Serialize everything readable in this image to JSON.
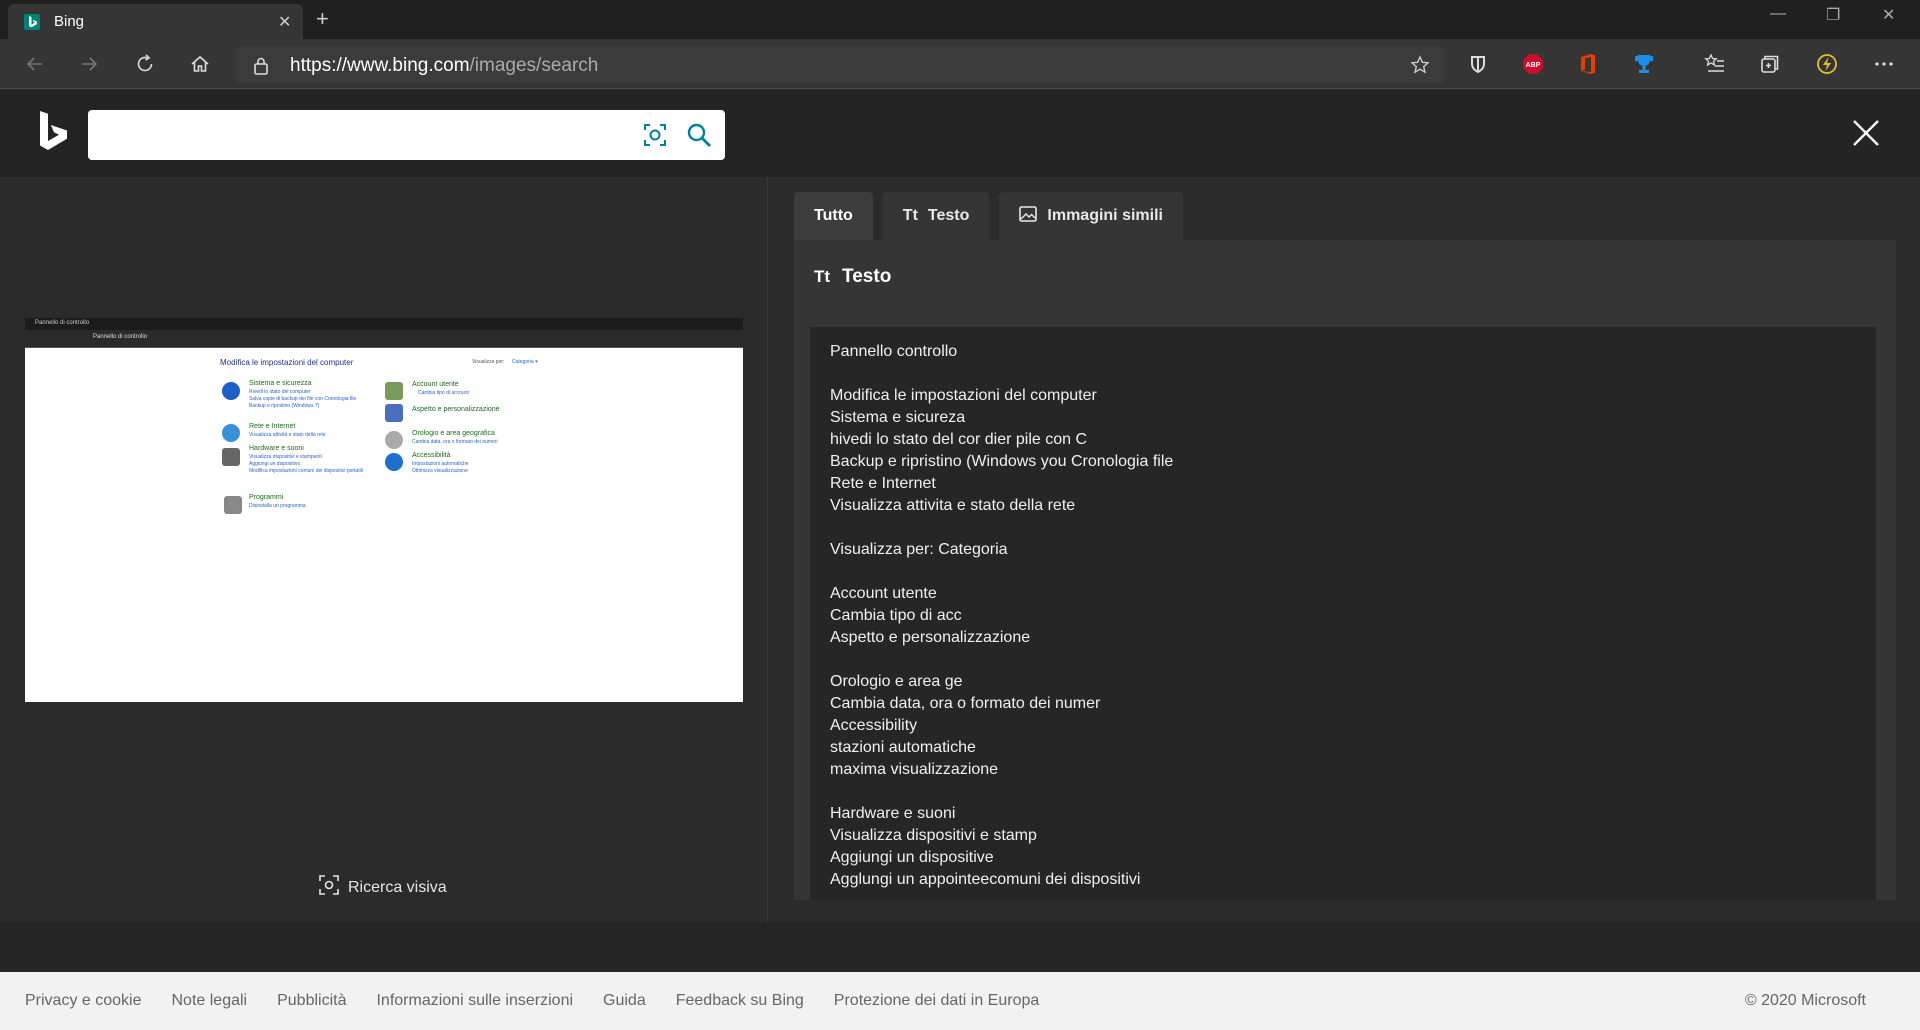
{
  "browser": {
    "tab_title": "Bing",
    "url_host": "https://www.bing.com",
    "url_path": "/images/search",
    "colors": {
      "chrome_dark": "#202020",
      "toolbar": "#353535",
      "bing_teal": "#008373"
    }
  },
  "extensions": [
    "shield-extension",
    "adblock-plus",
    "office",
    "trophy-extension",
    "favorites",
    "collections",
    "performance",
    "more"
  ],
  "extension_labels": {
    "adblock": "ABP"
  },
  "bing": {
    "search_placeholder": "",
    "visual_search_label": "Ricerca visiva"
  },
  "preview": {
    "window_title": "Pannello di controllo",
    "address": "Pannello di controllo",
    "heading": "Modifica le impostazioni del computer",
    "view_by": "Visualizza per:",
    "view_value": "Categoria ▾",
    "items": [
      {
        "title": "Sistema e sicurezza",
        "subs": [
          "Rivedi lo stato del computer",
          "Salva copie di backup dei file con Cronologia file",
          "Backup e ripristino (Windows 7)"
        ]
      },
      {
        "title": "Rete e Internet",
        "subs": [
          "Visualizza attività e stato della rete"
        ]
      },
      {
        "title": "Hardware e suoni",
        "subs": [
          "Visualizza dispositivi e stampanti",
          "Aggiungi un dispositivo",
          "Modifica impostazioni comuni dei dispositivi portatili"
        ]
      },
      {
        "title": "Programmi",
        "subs": [
          "Disinstalla un programma"
        ]
      },
      {
        "title": "Account utente",
        "subs": [
          "Cambia tipo di account"
        ]
      },
      {
        "title": "Aspetto e personalizzazione",
        "subs": []
      },
      {
        "title": "Orologio e area geografica",
        "subs": [
          "Cambia data, ora o formato dei numeri"
        ]
      },
      {
        "title": "Accessibilità",
        "subs": [
          "Impostazioni automatiche",
          "Ottimizza visualizzazione"
        ]
      }
    ]
  },
  "results": {
    "tabs": [
      {
        "label": "Tutto",
        "active": true
      },
      {
        "label": "Testo",
        "active": false
      },
      {
        "label": "Immagini simili",
        "active": false
      }
    ],
    "tt_glyph": "Tt",
    "section_title": "Testo",
    "text_lines": [
      "Pannello controllo",
      "",
      "Modifica le impostazioni del computer",
      "Sistema e sicureza",
      "hivedi lo stato del cor dier pile con C",
      "Backup e ripristino (Windows you Cronologia file",
      "Rete e Internet",
      "Visualizza attivita e stato della rete",
      "",
      "Visualizza per: Categoria",
      "",
      "Account utente",
      "Cambia tipo di acc",
      "Aspetto e personalizzazione",
      "",
      "Orologio e area ge",
      "Cambia data, ora o formato dei numer",
      "Accessibility",
      "stazioni automatiche",
      "maxima visualizzazione",
      "",
      "Hardware e suoni",
      "Visualizza dispositivi e stamp",
      "Aggiungi un dispositive",
      "Agglungi un appointeecomuni dei dispositivi"
    ]
  },
  "footer": {
    "links": [
      "Privacy e cookie",
      "Note legali",
      "Pubblicità",
      "Informazioni sulle inserzioni",
      "Guida",
      "Feedback su Bing",
      "Protezione dei dati in Europa"
    ],
    "copyright": "© 2020 Microsoft"
  }
}
